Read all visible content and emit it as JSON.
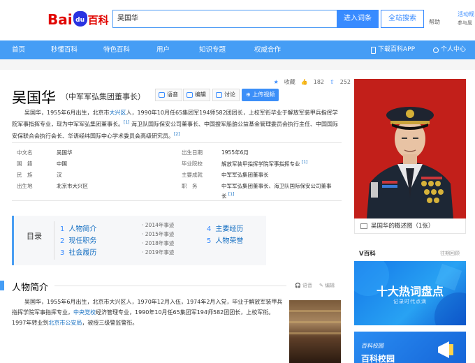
{
  "header": {
    "logo_text_left": "Bai",
    "logo_paw_text": "du",
    "logo_text_right": "百科",
    "search_value": "吴国华",
    "search_button": "进入词条",
    "site_search_button": "全站搜索",
    "help": "帮助",
    "activity": "活动规",
    "activity_sub": "参与属"
  },
  "nav": {
    "items": [
      "首页",
      "秒懂百科",
      "特色百科",
      "用户",
      "知识专题",
      "权威合作"
    ],
    "download": "下载百科APP",
    "personal": "个人中心"
  },
  "stats": {
    "collect": "收藏",
    "likes": "182",
    "shares": "252"
  },
  "entry": {
    "title": "吴国华",
    "subtitle": "（中军军弘集团董事长）",
    "buttons": [
      "语音",
      "编辑",
      "讨论"
    ],
    "upload": "上传视频",
    "summary_p1": "吴国华，1955年6月出生，北京市",
    "summary_link1": "大兴区",
    "summary_p2": "人，1990年10月任65集团军194师582团团长，上校军衔毕业于解放军装甲兵指挥学院军事指挥专业，现为中军军弘集团董事长。",
    "sup1": "[1]",
    "summary_p3": "海卫队国际保安公司董事长、中国搜军船舶公益基金管理委员会执行主任、中国国际安保联合会执行会长、华语经纬国际中心学术委员会高级研究员。",
    "sup2": "[2]"
  },
  "info": {
    "left": [
      {
        "k": "中文名",
        "v": "吴国华"
      },
      {
        "k": "国　籍",
        "v": "中国"
      },
      {
        "k": "民　族",
        "v": "汉"
      },
      {
        "k": "出生地",
        "v": "北京市大兴区"
      }
    ],
    "right": [
      {
        "k": "出生日期",
        "v": "1955年6月"
      },
      {
        "k": "毕业院校",
        "v": "解放军装甲指挥学院军事指挥专业"
      },
      {
        "k": "主要成就",
        "v": "中军军弘集团董事长"
      },
      {
        "k": "职　务",
        "v": "中军军弘集团董事长、海卫队国际保安公司董事"
      },
      {
        "k": "",
        "v": "长"
      }
    ],
    "sup": "[1]"
  },
  "catalog": {
    "label": "目录",
    "items": [
      {
        "n": "1",
        "label": "人物简介"
      },
      {
        "n": "2",
        "label": "现任职务"
      },
      {
        "n": "3",
        "label": "社会履历"
      },
      {
        "n": "4",
        "label": "主要经历"
      },
      {
        "n": "5",
        "label": "人物荣誉"
      }
    ],
    "subs": [
      "2014年事迹",
      "2015年事迹",
      "2018年事迹",
      "2019年事迹"
    ]
  },
  "section": {
    "title": "人物简介",
    "tool_voice": "语音",
    "tool_edit": "编辑",
    "body_a": "吴国华，1955年6月出生，北京市大兴区人，1970年12月入伍，1974年2月入党，毕业于解放军装甲兵指挥学院军事指挥专业，",
    "body_link1": "中央党校",
    "body_b": "经济管理专业，1990年10月任65集团军194师582团团长，上校军衔。1997年转业到",
    "body_link2": "北京市公安局",
    "body_c": "，被授三级警监警衔。"
  },
  "sidebar": {
    "caption": "吴国华的概述图（1张）",
    "vbaike": "V百科",
    "vbaike_more": "往期回顾",
    "hot_title": "十大热词盘点",
    "hot_sub": "记录时代点滴",
    "school_top": "百科校园",
    "school_title": "百科校园"
  }
}
